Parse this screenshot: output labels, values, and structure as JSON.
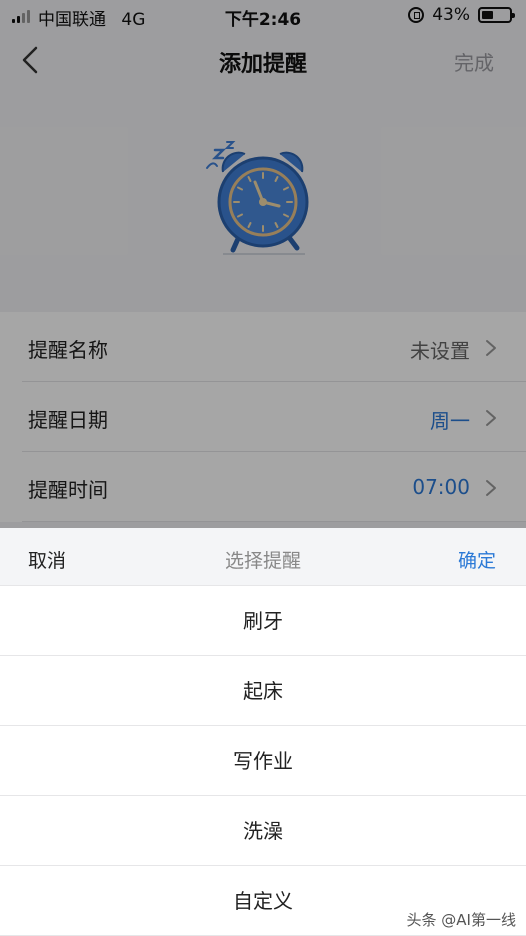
{
  "status_bar": {
    "carrier": "中国联通",
    "network": "4G",
    "time": "下午2:46",
    "battery_percent_text": "43%",
    "battery_level": 0.43
  },
  "nav": {
    "title": "添加提醒",
    "done_label": "完成",
    "back_icon": "chevron-left-icon"
  },
  "hero": {
    "icon": "alarm-clock-icon",
    "accent": "#3f7fd6"
  },
  "settings": {
    "rows": [
      {
        "label": "提醒名称",
        "value": "未设置"
      },
      {
        "label": "提醒日期",
        "value": "周一"
      },
      {
        "label": "提醒时间",
        "value": "07:00"
      }
    ]
  },
  "picker": {
    "cancel_label": "取消",
    "title": "选择提醒",
    "confirm_label": "确定",
    "options": [
      "刷牙",
      "起床",
      "写作业",
      "洗澡",
      "自定义"
    ]
  },
  "watermark": "头条 @AI第一线",
  "colors": {
    "accent_blue": "#2b79d6",
    "overlay": "rgba(0,0,0,0.35)"
  }
}
